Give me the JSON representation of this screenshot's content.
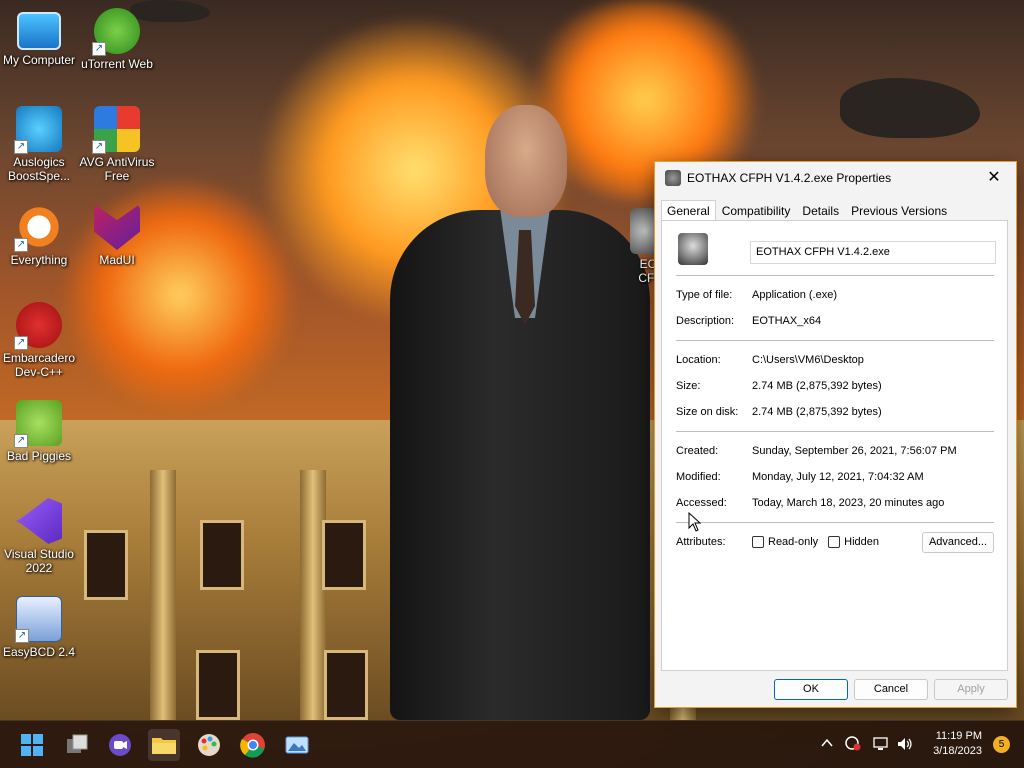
{
  "desktop": {
    "icons": [
      {
        "label": "My Computer"
      },
      {
        "label": "uTorrent Web"
      },
      {
        "label": "Auslogics BoostSpe..."
      },
      {
        "label": "AVG AntiVirus Free"
      },
      {
        "label": "Everything"
      },
      {
        "label": "MadUI"
      },
      {
        "label": "Embarcadero Dev-C++"
      },
      {
        "label": "Bad Piggies"
      },
      {
        "label": "Visual Studio 2022"
      },
      {
        "label": "EasyBCD 2.4"
      }
    ],
    "partial_icon_label": "EC CFI"
  },
  "dialog": {
    "title": "EOTHAX CFPH V1.4.2.exe Properties",
    "close_glyph": "✕",
    "tabs": [
      {
        "label": "General",
        "active": true
      },
      {
        "label": "Compatibility"
      },
      {
        "label": "Details"
      },
      {
        "label": "Previous Versions"
      }
    ],
    "file_name": "EOTHAX CFPH V1.4.2.exe",
    "type_label": "Type of file:",
    "type_value": "Application (.exe)",
    "description_label": "Description:",
    "description_value": "EOTHAX_x64",
    "location_label": "Location:",
    "location_value": "C:\\Users\\VM6\\Desktop",
    "size_label": "Size:",
    "size_value": "2.74 MB (2,875,392 bytes)",
    "size_on_disk_label": "Size on disk:",
    "size_on_disk_value": "2.74 MB (2,875,392 bytes)",
    "created_label": "Created:",
    "created_value": "Sunday, September 26, 2021, 7:56:07 PM",
    "modified_label": "Modified:",
    "modified_value": "Monday, July 12, 2021, 7:04:32 AM",
    "accessed_label": "Accessed:",
    "accessed_value": "Today, March 18, 2023, 20 minutes ago",
    "attributes_label": "Attributes:",
    "readonly_label": "Read-only",
    "hidden_label": "Hidden",
    "advanced_label": "Advanced...",
    "ok_label": "OK",
    "cancel_label": "Cancel",
    "apply_label": "Apply"
  },
  "taskbar": {
    "time": "11:19 PM",
    "date": "3/18/2023",
    "notification_count": "5",
    "apps": [
      "start-icon",
      "task-view-icon",
      "chat-icon",
      "file-explorer-icon",
      "paint-icon",
      "chrome-icon",
      "photos-icon"
    ],
    "tray_icons": [
      "chevron-up-icon",
      "sync-icon",
      "network-icon",
      "volume-icon"
    ]
  },
  "colors": {
    "accent": "#0067c0",
    "dialog_border": "#e0a030",
    "taskbar_bg": "#28190f"
  }
}
